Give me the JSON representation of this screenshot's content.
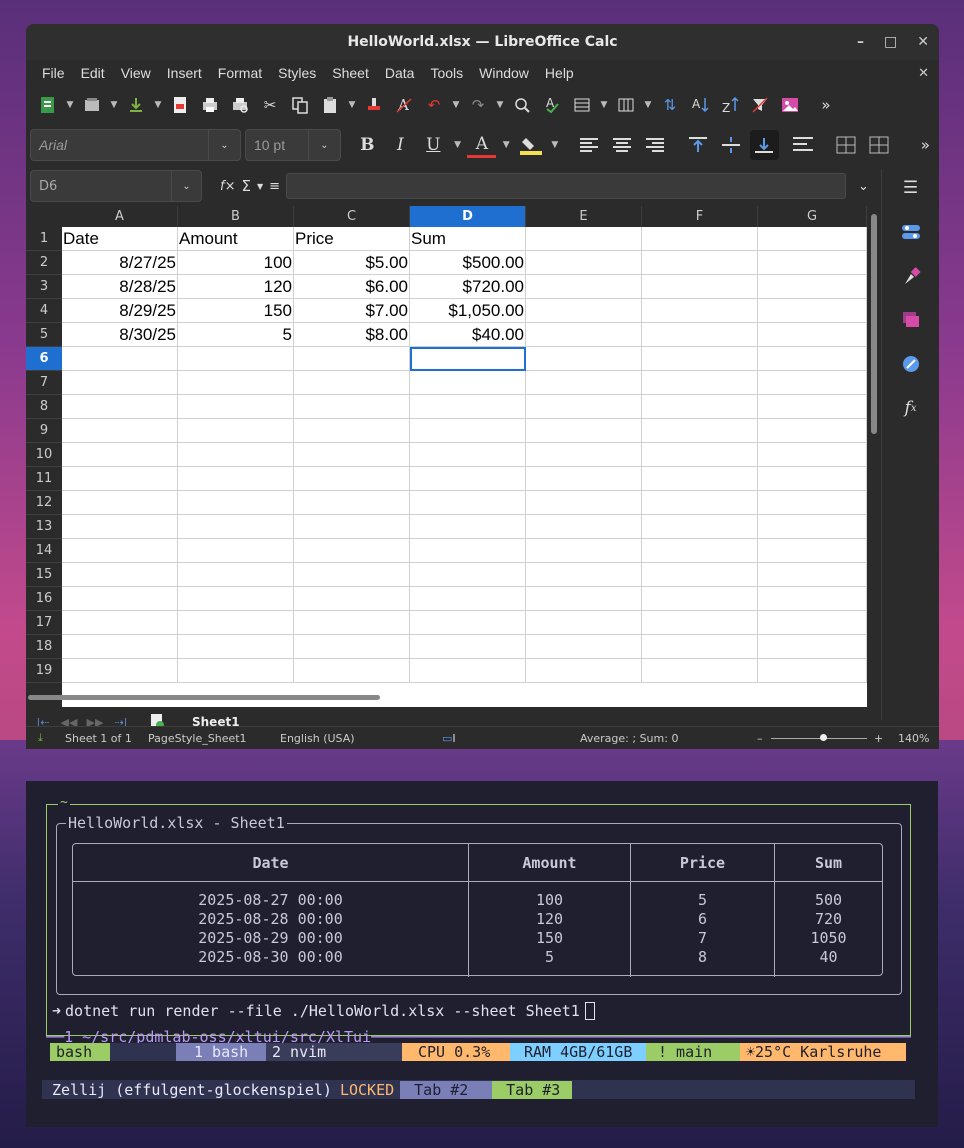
{
  "window": {
    "title": "HelloWorld.xlsx — LibreOffice Calc",
    "controls": {
      "minimize": "–",
      "maximize": "□",
      "close": "✕"
    }
  },
  "menu": [
    "File",
    "Edit",
    "View",
    "Insert",
    "Format",
    "Styles",
    "Sheet",
    "Data",
    "Tools",
    "Window",
    "Help"
  ],
  "menu_close": "✕",
  "format_toolbar": {
    "font_name": "Arial",
    "font_size": "10 pt",
    "bold": "B",
    "italic": "I",
    "underline": "U",
    "font_color": "A"
  },
  "formula_bar": {
    "name_box": "D6",
    "fx": "f×",
    "sigma": "Σ",
    "equals": "≡",
    "content": ""
  },
  "grid": {
    "columns": [
      "A",
      "B",
      "C",
      "D",
      "E",
      "F",
      "G"
    ],
    "selected_column": "D",
    "rows": [
      "1",
      "2",
      "3",
      "4",
      "5",
      "6",
      "7",
      "8",
      "9",
      "10",
      "11",
      "12",
      "13",
      "14",
      "15",
      "16",
      "17",
      "18",
      "19"
    ],
    "selected_row": "6",
    "cells": [
      [
        "Date",
        "Amount",
        "Price",
        "Sum",
        "",
        "",
        ""
      ],
      [
        "8/27/25",
        "100",
        "$5.00",
        "$500.00",
        "",
        "",
        ""
      ],
      [
        "8/28/25",
        "120",
        "$6.00",
        "$720.00",
        "",
        "",
        ""
      ],
      [
        "8/29/25",
        "150",
        "$7.00",
        "$1,050.00",
        "",
        "",
        ""
      ],
      [
        "8/30/25",
        "5",
        "$8.00",
        "$40.00",
        "",
        "",
        ""
      ]
    ]
  },
  "sheet_tabs": {
    "active": "Sheet1"
  },
  "status": {
    "sheet": "Sheet 1 of 1",
    "page_style": "PageStyle_Sheet1",
    "language": "English (USA)",
    "summary": "Average: ; Sum: 0",
    "zoom": "140%",
    "zoom_minus": "–",
    "zoom_plus": "+"
  },
  "terminal": {
    "pane_title": "~",
    "panel_title": "HelloWorld.xlsx - Sheet1",
    "table": {
      "headers": [
        "Date",
        "Amount",
        "Price",
        "Sum"
      ],
      "rows": [
        [
          "2025-08-27 00:00",
          "100",
          "5",
          "500"
        ],
        [
          "2025-08-28 00:00",
          "120",
          "6",
          "720"
        ],
        [
          "2025-08-29 00:00",
          "150",
          "7",
          "1050"
        ],
        [
          "2025-08-30 00:00",
          "5",
          "8",
          "40"
        ]
      ]
    },
    "prompt_symbol": "➜",
    "command": "dotnet run render --file ./HelloWorld.xlsx --sheet Sheet1",
    "pane_footer": "1 ~/src/pdmlab-oss/xltui/src/XlTui",
    "status_segments": {
      "shell": "bash",
      "win1": "1 bash",
      "win2": "2 nvim",
      "cpu": "CPU  0.3%",
      "ram": "RAM 4GB/61GB",
      "git": "!  main",
      "weather": "☀25°C Karlsruhe"
    },
    "zellij": {
      "session": "Zellij (effulgent-glockenspiel)",
      "mode": "LOCKED",
      "tab2": "Tab #2",
      "tab3": "Tab #3"
    }
  },
  "colors": {
    "selection": "#1e6fd0",
    "green_accent": "#9ccc65",
    "purple_accent": "#bb9af7",
    "orange_accent": "#ffb86c",
    "blue_accent": "#7dcfff"
  }
}
